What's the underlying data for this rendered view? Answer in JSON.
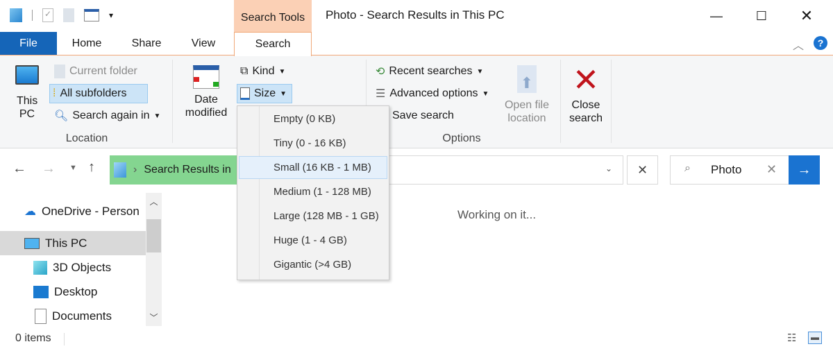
{
  "window": {
    "title": "Photo - Search Results in This PC",
    "context_tab": "Search Tools"
  },
  "tabs": [
    {
      "label": "File"
    },
    {
      "label": "Home"
    },
    {
      "label": "Share"
    },
    {
      "label": "View"
    },
    {
      "label": "Search"
    }
  ],
  "ribbon": {
    "location": {
      "this_pc": "This PC",
      "current_folder": "Current folder",
      "all_subfolders": "All subfolders",
      "search_again_in": "Search again in",
      "group": "Location"
    },
    "refine": {
      "date_modified": "Date modified",
      "kind": "Kind",
      "size": "Size"
    },
    "options": {
      "recent_searches": "Recent searches",
      "advanced_options": "Advanced options",
      "save_search": "Save search",
      "open_file_location": "Open file location",
      "group": "Options"
    },
    "close_search": "Close search"
  },
  "size_menu": {
    "items": [
      "Empty (0 KB)",
      "Tiny (0 - 16 KB)",
      "Small (16 KB - 1 MB)",
      "Medium (1 - 128 MB)",
      "Large (128 MB - 1 GB)",
      "Huge (1 - 4 GB)",
      "Gigantic (>4 GB)"
    ],
    "highlighted": "Small (16 KB - 1 MB)"
  },
  "address": {
    "breadcrumb": "Search Results in This PC",
    "breadcrumb_visible": "Search Results in"
  },
  "search": {
    "value": "Photo"
  },
  "nav_pane": {
    "items": [
      "OneDrive - Person",
      "This PC",
      "3D Objects",
      "Desktop",
      "Documents"
    ],
    "selected": "This PC"
  },
  "content": {
    "status": "Working on it..."
  },
  "status_bar": {
    "items": "0 items"
  },
  "colors": {
    "accent": "#1a73d1",
    "file_tab": "#1565b8",
    "context_tab": "#fbd0b5",
    "breadcrumb_bg": "#84d590",
    "close_x": "#c0141c"
  }
}
